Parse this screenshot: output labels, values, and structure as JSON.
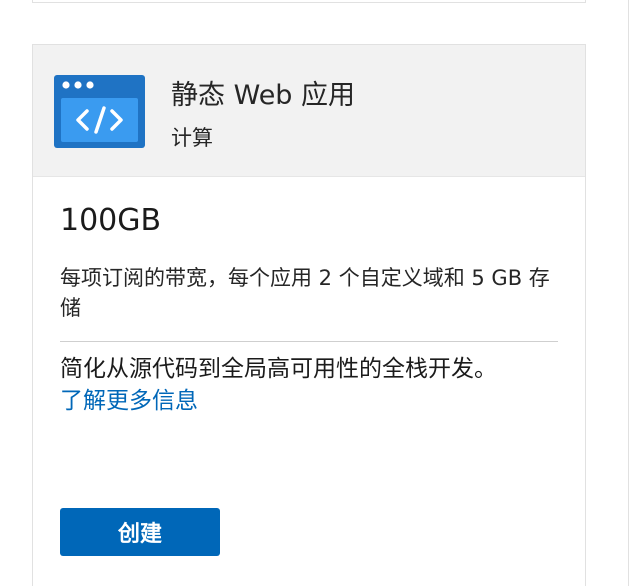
{
  "card": {
    "icon": "code-window-icon",
    "title": "静态 Web 应用",
    "category": "计算",
    "price": "100GB",
    "description": "每项订阅的带宽，每个应用 2 个自定义域和 5 GB 存储",
    "summary": "简化从源代码到全局高可用性的全栈开发。",
    "learn_more_label": "了解更多信息",
    "create_label": "创建"
  },
  "colors": {
    "accent": "#0067b8",
    "header_bg": "#f2f2f2",
    "icon_blue": "#1f73c4",
    "icon_light": "#3a9bf0"
  }
}
